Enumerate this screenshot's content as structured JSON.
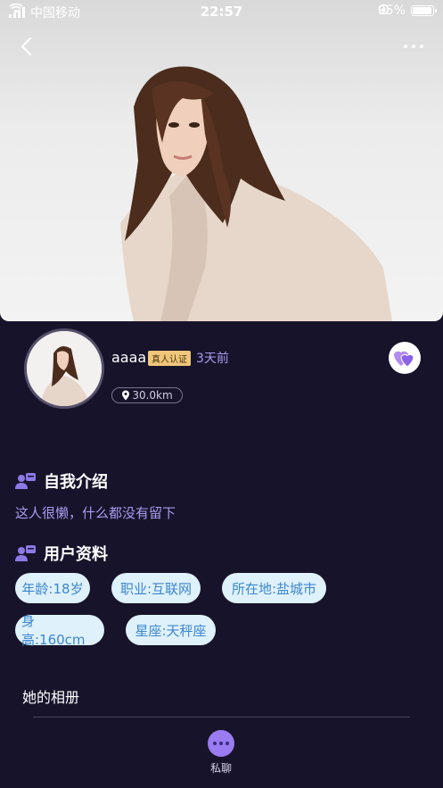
{
  "status_bar": {
    "carrier": "中国移动",
    "time": "22:57",
    "battery": "95%"
  },
  "header": {
    "back_icon": "chevron-left-icon",
    "more_icon": "more-horizontal-icon"
  },
  "profile": {
    "nickname": "aaaa",
    "verified_badge": "真人认证",
    "last_active": "3天前",
    "distance": "30.0km",
    "like_icon": "double-heart-icon"
  },
  "intro": {
    "title": "自我介绍",
    "text": "这人很懒，什么都没有留下",
    "icon": "user-card-icon"
  },
  "info": {
    "title": "用户资料",
    "icon": "user-card-icon",
    "tags": [
      "年龄:18岁",
      "职业:互联网",
      "所在地:盐城市",
      "身高:160cm",
      "星座:天秤座"
    ]
  },
  "album": {
    "title": "她的相册"
  },
  "bottom": {
    "chat_label": "私聊",
    "chat_icon": "chat-bubble-icon"
  },
  "colors": {
    "background": "#17132a",
    "accent_purple": "#a99bf0",
    "tag_bg": "#dff1fb",
    "tag_text": "#3c87cf",
    "badge_gold": "#f0c77a"
  }
}
